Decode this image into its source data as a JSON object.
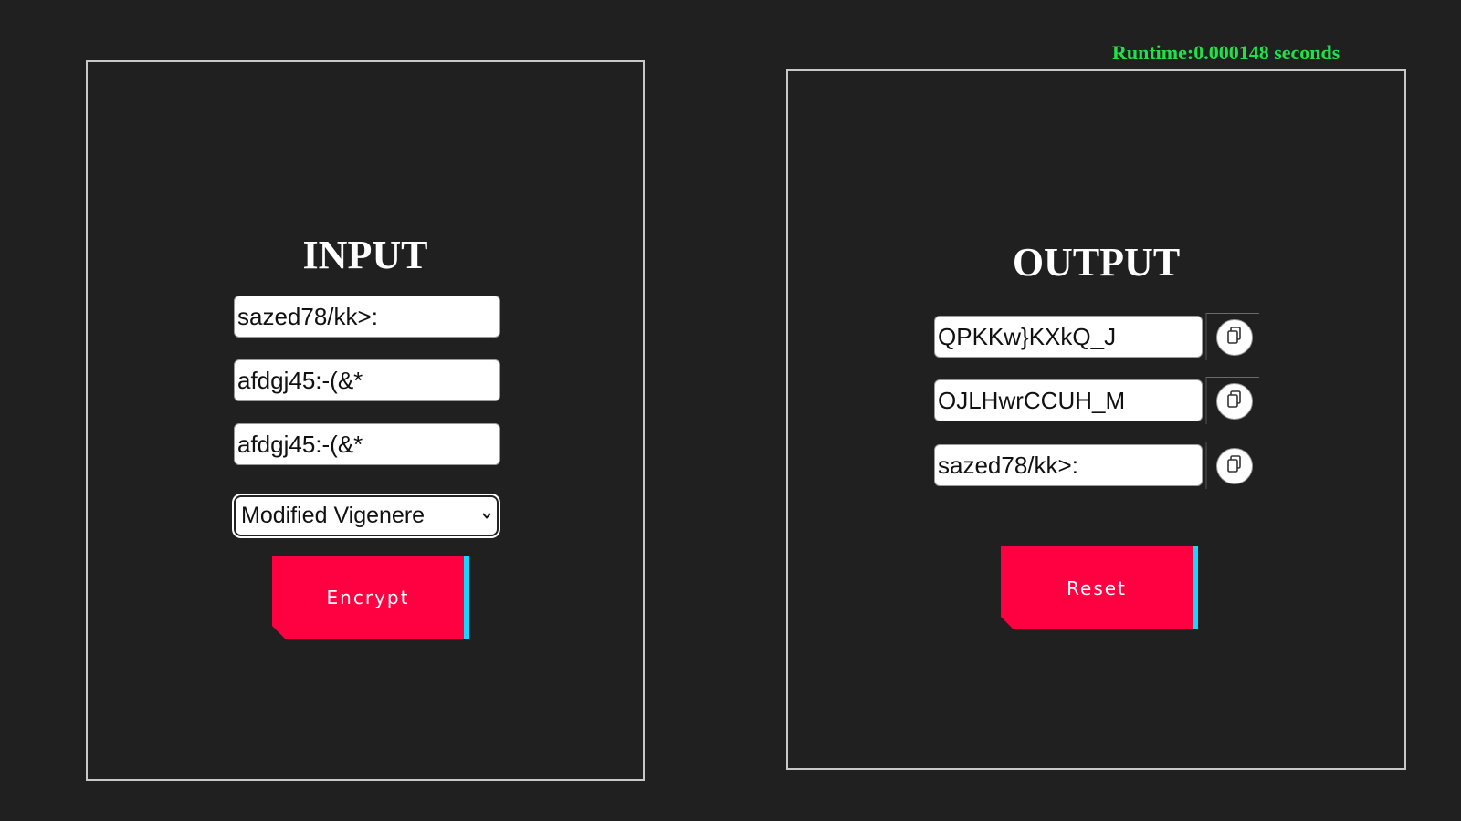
{
  "runtime": "Runtime:0.000148 seconds",
  "input_panel": {
    "title": "INPUT",
    "fields": [
      {
        "value": "sazed78/kk>:"
      },
      {
        "value": "afdgj45:-(&*"
      },
      {
        "value": "afdgj45:-(&*"
      }
    ],
    "cipher_select": {
      "selected": "Modified Vigenere"
    },
    "encrypt_label": "Encrypt"
  },
  "output_panel": {
    "title": "OUTPUT",
    "fields": [
      {
        "value": "QPKKw}KXkQ_J"
      },
      {
        "value": "OJLHwrCCUH_M"
      },
      {
        "value": "sazed78/kk>:"
      }
    ],
    "copy_icon": "copy-icon",
    "reset_label": "Reset"
  },
  "colors": {
    "background": "#202020",
    "runtime_text": "#22e04a",
    "button": "#ff0040",
    "button_accent": "#18d6ff"
  }
}
